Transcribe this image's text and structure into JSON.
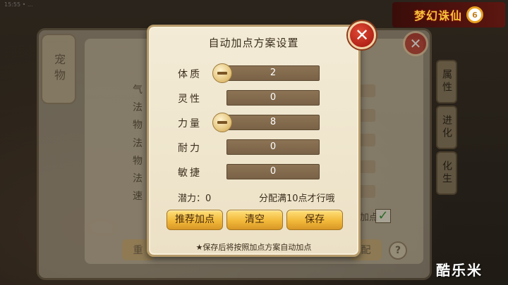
{
  "background": {
    "status_text": "15:55 • ...",
    "side_tab": "宠物",
    "right_tabs": [
      "属性",
      "进化",
      "化生"
    ],
    "stat_labels": [
      "气",
      "法",
      "物",
      "法",
      "物",
      "法",
      "速"
    ],
    "left_button": "重",
    "right_button": "配",
    "help": "?",
    "check_label": "加点",
    "logo_text": "梦幻诛仙",
    "logo_badge": "6",
    "watermark": "酷乐米"
  },
  "dialog": {
    "title": "自动加点方案设置",
    "close_symbol": "✕",
    "rows": [
      {
        "label": "体质",
        "value": "2",
        "has_minus": true
      },
      {
        "label": "灵性",
        "value": "0",
        "has_minus": false
      },
      {
        "label": "力量",
        "value": "8",
        "has_minus": true
      },
      {
        "label": "耐力",
        "value": "0",
        "has_minus": false
      },
      {
        "label": "敏捷",
        "value": "0",
        "has_minus": false
      }
    ],
    "potential": "潜力：0",
    "hint": "分配满10点才行哦",
    "buttons": {
      "recommend": "推荐加点",
      "clear": "清空",
      "save": "保存"
    },
    "footnote": "★保存后将按照加点方案自动加点"
  },
  "colors": {
    "dialog_bg": "#f0e7d0",
    "field_bg": "#7f6a4c",
    "button_gold": "#f2b93a",
    "close_red": "#c4321f"
  }
}
